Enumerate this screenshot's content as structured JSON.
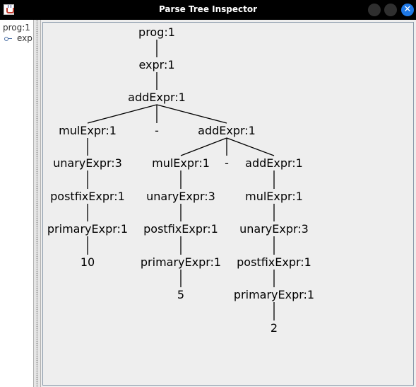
{
  "window": {
    "title": "Parse Tree Inspector"
  },
  "icons": {
    "app": "java-cup-icon",
    "minimize": "minimize-icon",
    "maximize": "maximize-icon",
    "close": "close-icon",
    "tree_node": "key-icon"
  },
  "colors": {
    "titlebar": "#000000",
    "close_button": "#1e78e6",
    "canvas_background": "#eeeeee"
  },
  "sidebar": {
    "root_label": "prog:1",
    "child_label": "exp"
  },
  "parse_tree": {
    "nodes": [
      "prog:1",
      "expr:1",
      "addExpr:1",
      "mulExpr:1",
      "-",
      "addExpr:1",
      "unaryExpr:3",
      "postfixExpr:1",
      "primaryExpr:1",
      "10",
      "mulExpr:1",
      "-",
      "addExpr:1",
      "unaryExpr:3",
      "postfixExpr:1",
      "primaryExpr:1",
      "5",
      "mulExpr:1",
      "unaryExpr:3",
      "postfixExpr:1",
      "primaryExpr:1",
      "2"
    ],
    "edges": [
      [
        0,
        1
      ],
      [
        1,
        2
      ],
      [
        2,
        3
      ],
      [
        2,
        4
      ],
      [
        2,
        5
      ],
      [
        3,
        6
      ],
      [
        6,
        7
      ],
      [
        7,
        8
      ],
      [
        8,
        9
      ],
      [
        5,
        10
      ],
      [
        5,
        11
      ],
      [
        5,
        12
      ],
      [
        10,
        13
      ],
      [
        13,
        14
      ],
      [
        14,
        15
      ],
      [
        15,
        16
      ],
      [
        12,
        17
      ],
      [
        17,
        18
      ],
      [
        18,
        19
      ],
      [
        19,
        20
      ],
      [
        20,
        21
      ]
    ]
  }
}
